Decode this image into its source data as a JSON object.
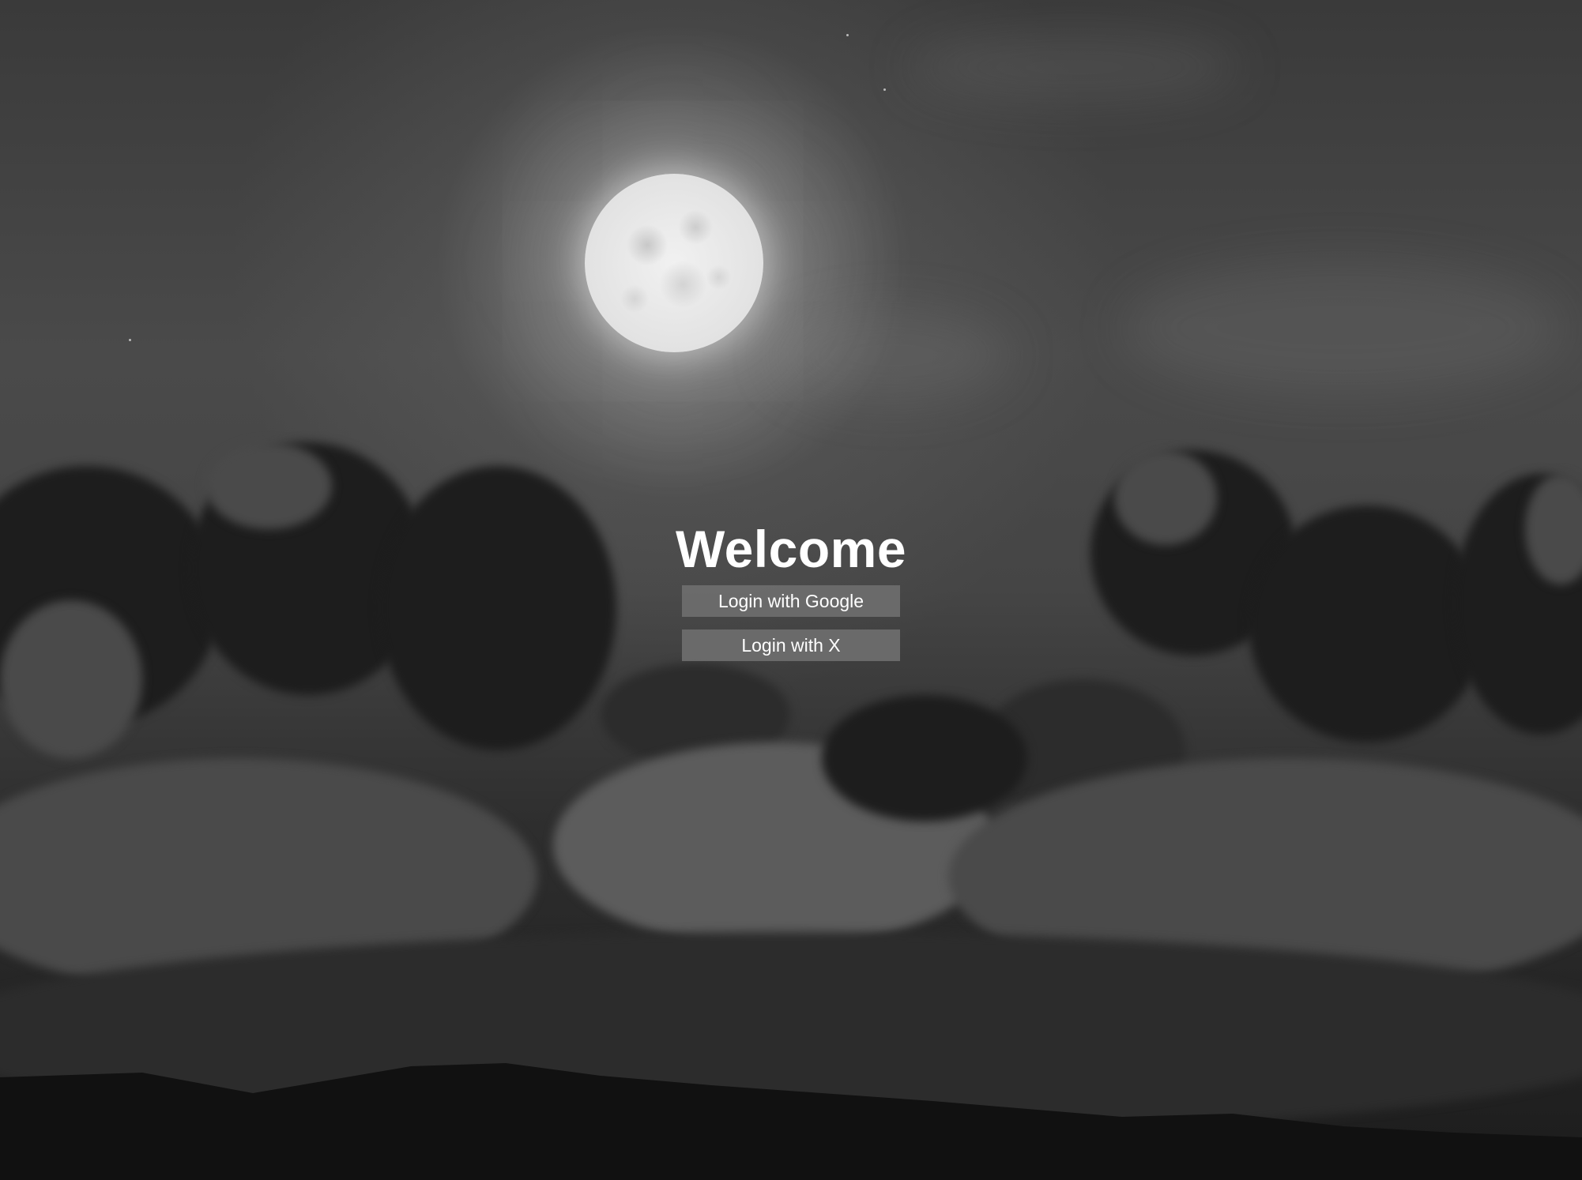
{
  "page": {
    "heading": "Welcome"
  },
  "buttons": {
    "google_label": "Login with Google",
    "x_label": "Login with X"
  },
  "colors": {
    "heading_text": "#ffffff",
    "button_background": "#6e6e6e",
    "button_text": "#ffffff"
  },
  "background": {
    "scene": "moonlit-night-clouds",
    "icons": [
      "moon",
      "clouds",
      "hills",
      "stars"
    ]
  }
}
